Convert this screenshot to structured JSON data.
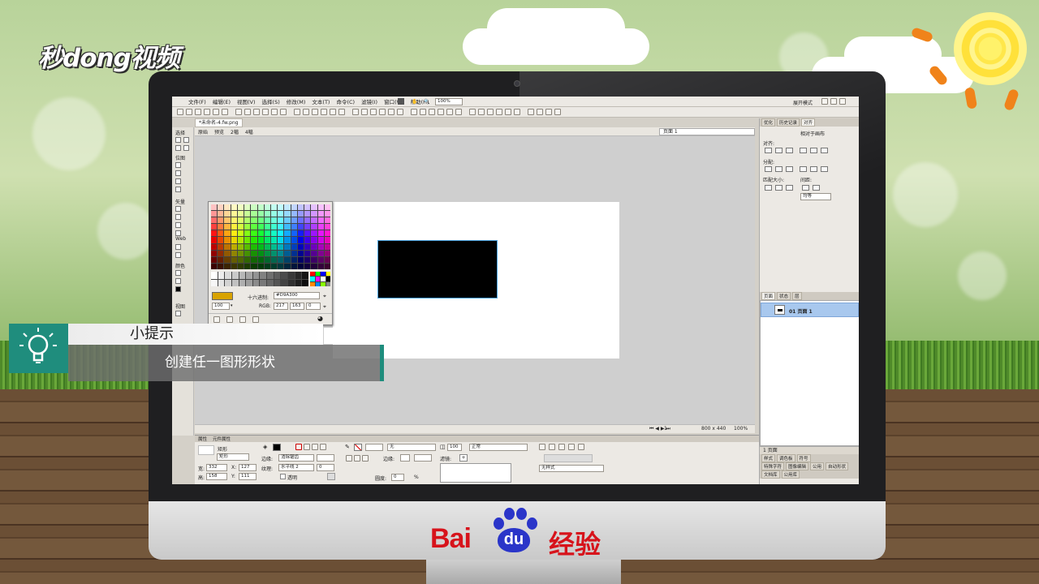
{
  "brand": {
    "top_logo": "秒dong视频",
    "bottom_logo_bai": "Bai",
    "bottom_logo_du": "du",
    "bottom_logo_suffix": "经验"
  },
  "app": {
    "menu": [
      "文件(F)",
      "编辑(E)",
      "视图(V)",
      "选择(S)",
      "修改(M)",
      "文本(T)",
      "命令(C)",
      "滤镜(I)",
      "窗口(W)",
      "帮助(H)"
    ],
    "zoom_value": "100%",
    "workspace_mode": "展开模式",
    "document_tab": "*未命名-4.fw.png",
    "view_tabs": [
      "原始",
      "预览",
      "2幅",
      "4幅"
    ],
    "page_select": "页面 1",
    "tool_sections": [
      "选择",
      "位图",
      "矢量",
      "Web",
      "颜色",
      "视图"
    ]
  },
  "color_picker": {
    "hex_label": "十六进制:",
    "hex_value": "#D9A300",
    "rgb_label": "RGB:",
    "r": "217",
    "g": "163",
    "b": "0",
    "opacity": "100",
    "current_color": "#d9a300"
  },
  "status": {
    "frame": "1",
    "size": "800 x 440",
    "zoom": "100%"
  },
  "right_panel": {
    "top_tabs": [
      "优化",
      "历史记录",
      "对齐"
    ],
    "relative": "相对于画布",
    "align": "对齐:",
    "distribute": "分配:",
    "match_size": "匹配大小:",
    "spacing": "间距:",
    "even": "均等",
    "pages_tabs": [
      "页面",
      "状态",
      "层"
    ],
    "page_name": "01 页面 1",
    "pages_footer": "1 页面",
    "bottom_tabs": [
      "样式",
      "调色板",
      "符号"
    ],
    "bottom_tabs2": [
      "特殊字符",
      "图像编辑",
      "公用",
      "自动形状"
    ],
    "bottom_tabs3": [
      "文档库",
      "公用库"
    ]
  },
  "properties": {
    "tabs": [
      "属性",
      "元件属性"
    ],
    "type": "矩形",
    "name": "矩形",
    "w_label": "宽:",
    "w": "332",
    "h_label": "高:",
    "h": "158",
    "x_label": "X:",
    "x": "127",
    "y_label": "Y:",
    "y": "111",
    "edge_label": "边缘:",
    "edge_value": "消除锯齿",
    "texture_label": "纹理:",
    "texture_value": "水平线 2",
    "texture_amount": "0",
    "transparent": "透明",
    "stroke_none": "无",
    "stroke_edge_label": "边缘:",
    "roundness_label": "圆度:",
    "roundness": "0",
    "opacity": "100",
    "blend": "正常",
    "filters_label": "滤镜:",
    "no_style": "无样式"
  },
  "tip": {
    "title": "小提示",
    "text": "创建任一图形形状"
  }
}
